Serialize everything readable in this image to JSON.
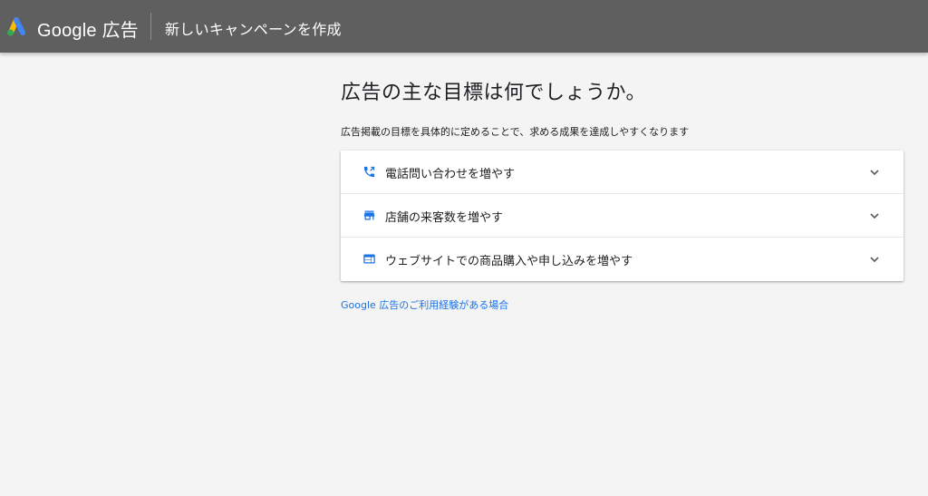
{
  "header": {
    "brand": "Google 広告",
    "title": "新しいキャンペーンを作成",
    "logo_icon": "google-ads-logo-icon"
  },
  "main": {
    "heading": "広告の主な目標は何でしょうか。",
    "description": "広告掲載の目標を具体的に定めることで、求める成果を達成しやすくなります",
    "goals": [
      {
        "label": "電話問い合わせを増やす",
        "icon": "phone-call-icon"
      },
      {
        "label": "店舗の来客数を増やす",
        "icon": "store-icon"
      },
      {
        "label": "ウェブサイトでの商品購入や申し込みを増やす",
        "icon": "web-page-icon"
      }
    ],
    "help_link": "Google 広告のご利用経験がある場合"
  },
  "colors": {
    "header_bg": "#5f5f5f",
    "page_bg": "#f4f4f4",
    "accent": "#1a73e8",
    "logo_blue": "#4285f4",
    "logo_yellow": "#fbbc04",
    "logo_green": "#34a853"
  }
}
